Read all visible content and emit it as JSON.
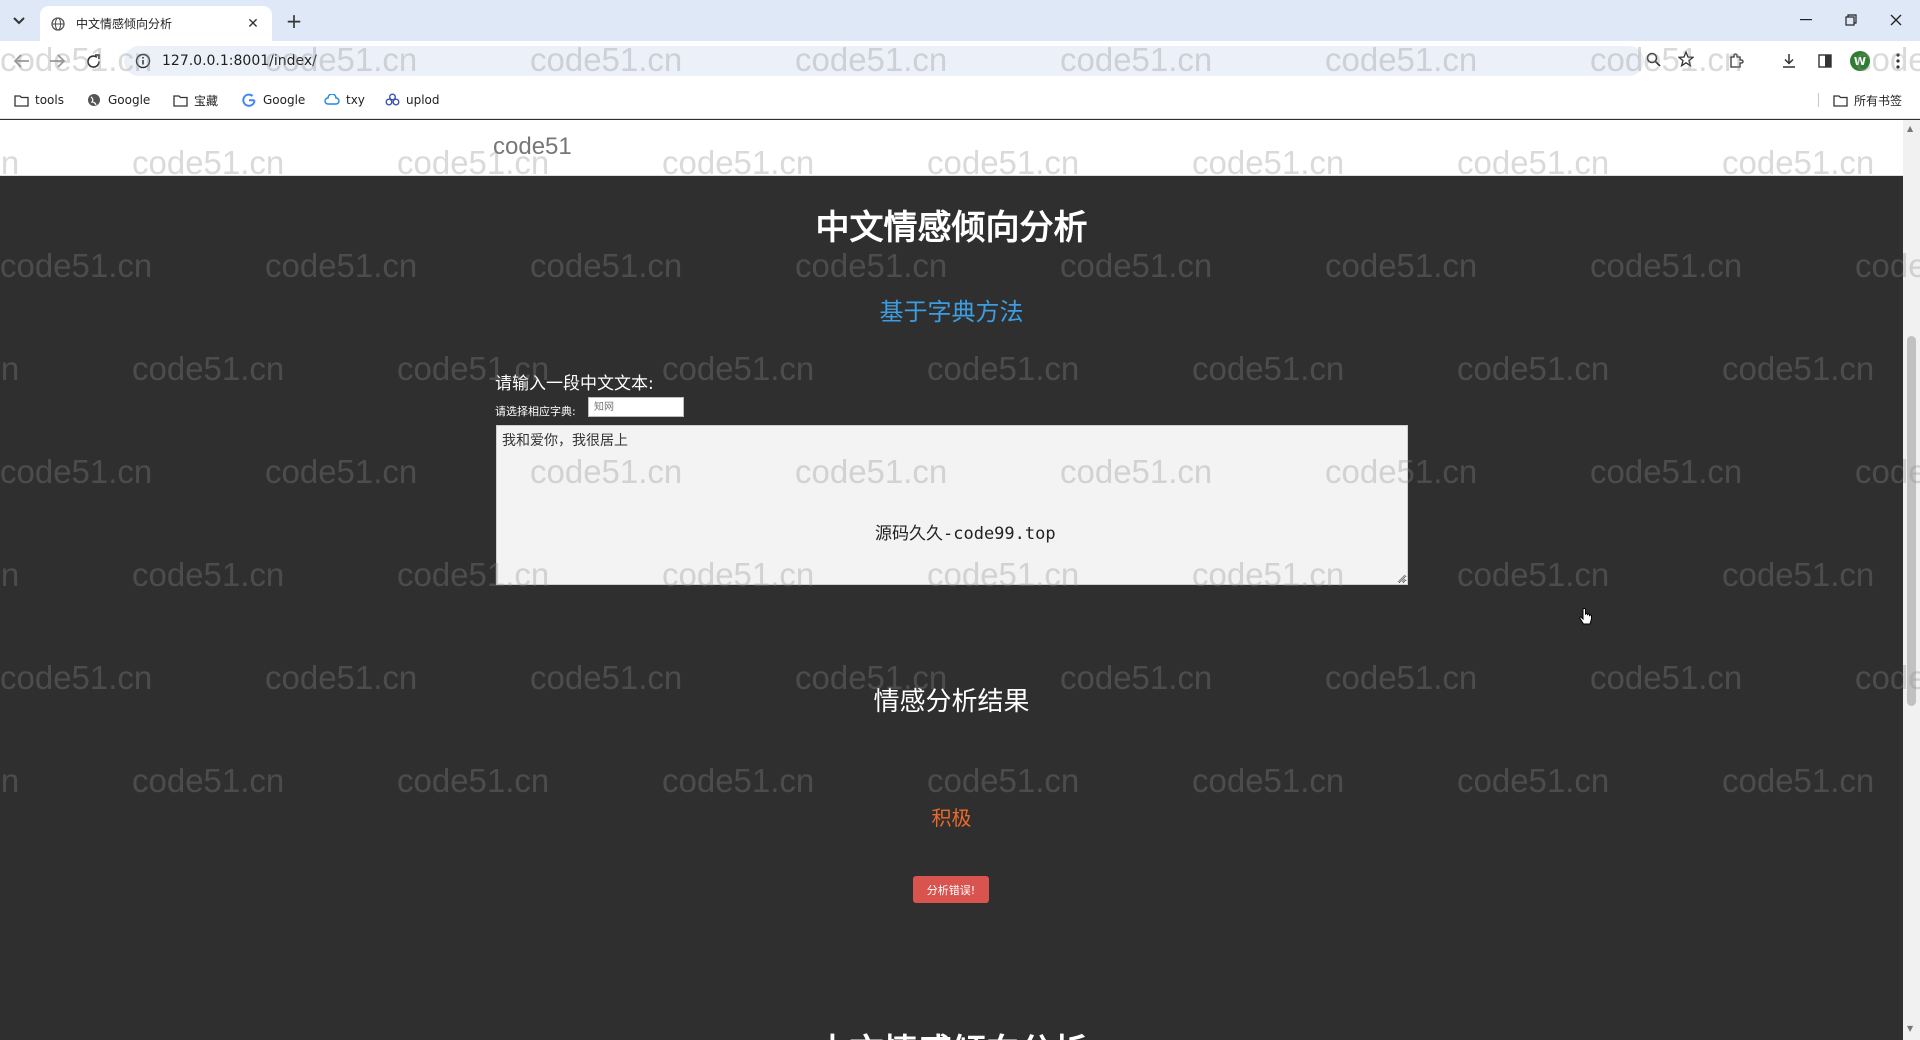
{
  "browser": {
    "tab_title": "中文情感倾向分析",
    "url": "127.0.0.1:8001/index/",
    "new_tab_symbol": "+",
    "close_symbol": "✕",
    "avatar_letter": "W",
    "bookmarks": [
      {
        "label": "tools",
        "icon": "folder-icon"
      },
      {
        "label": "Google",
        "icon": "globe-icon"
      },
      {
        "label": "宝藏",
        "icon": "folder-icon"
      },
      {
        "label": "Google",
        "icon": "google-icon"
      },
      {
        "label": "txy",
        "icon": "cloud-icon"
      },
      {
        "label": "uplod",
        "icon": "cluster-icon"
      }
    ],
    "all_bookmarks_label": "所有书签"
  },
  "site": {
    "brand": "code51"
  },
  "page": {
    "title": "中文情感倾向分析",
    "method_title": "基于字典方法",
    "prompt_label": "请输入一段中文文本:",
    "dict_label": "请选择相应字典:",
    "dict_placeholder": "知网",
    "text_value": "我和爱你，我很居上",
    "overlay_text": "源码久久-code99.top",
    "result_title": "情感分析结果",
    "result_value": "积极",
    "error_button_label": "分析错误!",
    "footer_title": "中文情感倾向分析"
  },
  "watermark": {
    "text": "code51.cn"
  },
  "colors": {
    "page_bg": "#2f2f2f",
    "method_title": "#3d9de0",
    "result_value": "#e86a2e",
    "error_button": "#d9534f"
  }
}
